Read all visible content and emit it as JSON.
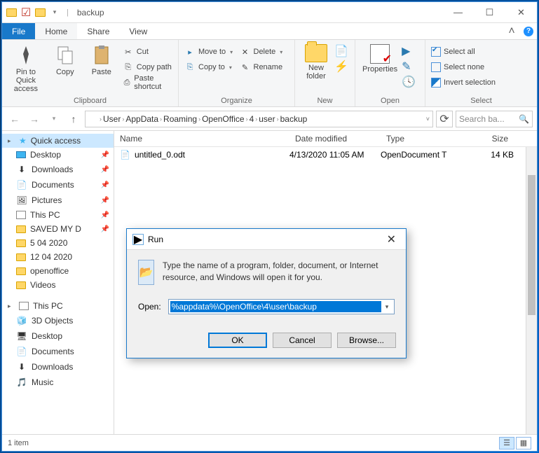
{
  "window_title": "backup",
  "menubar": {
    "file": "File",
    "tabs": [
      "Home",
      "Share",
      "View"
    ],
    "active": "Home"
  },
  "ribbon": {
    "clipboard": {
      "label": "Clipboard",
      "pin": "Pin to Quick\naccess",
      "copy": "Copy",
      "paste": "Paste",
      "cut": "Cut",
      "copy_path": "Copy path",
      "paste_shortcut": "Paste shortcut"
    },
    "organize": {
      "label": "Organize",
      "move": "Move to",
      "copy": "Copy to",
      "delete": "Delete",
      "rename": "Rename"
    },
    "new": {
      "label": "New",
      "folder": "New\nfolder"
    },
    "open": {
      "label": "Open",
      "properties": "Properties"
    },
    "select": {
      "label": "Select",
      "all": "Select all",
      "none": "Select none",
      "invert": "Invert selection"
    }
  },
  "breadcrumbs": [
    "User",
    "AppData",
    "Roaming",
    "OpenOffice",
    "4",
    "user",
    "backup"
  ],
  "search_placeholder": "Search ba...",
  "columns": {
    "name": "Name",
    "date": "Date modified",
    "type": "Type",
    "size": "Size"
  },
  "files": [
    {
      "name": "untitled_0.odt",
      "date": "4/13/2020 11:05 AM",
      "type": "OpenDocument T",
      "size": "14 KB"
    }
  ],
  "nav": {
    "quick_access": "Quick access",
    "quick_items": [
      {
        "label": "Desktop",
        "pinned": true,
        "icon": "monitor"
      },
      {
        "label": "Downloads",
        "pinned": true,
        "icon": "download"
      },
      {
        "label": "Documents",
        "pinned": true,
        "icon": "doc"
      },
      {
        "label": "Pictures",
        "pinned": true,
        "icon": "pic"
      },
      {
        "label": "This PC",
        "pinned": true,
        "icon": "pc"
      },
      {
        "label": "SAVED MY D",
        "pinned": true,
        "icon": "folder"
      },
      {
        "label": "5 04 2020",
        "pinned": false,
        "icon": "folder"
      },
      {
        "label": "12 04 2020",
        "pinned": false,
        "icon": "folder"
      },
      {
        "label": "openoffice",
        "pinned": false,
        "icon": "folder"
      },
      {
        "label": "Videos",
        "pinned": false,
        "icon": "folder"
      }
    ],
    "this_pc": "This PC",
    "pc_items": [
      "3D Objects",
      "Desktop",
      "Documents",
      "Downloads",
      "Music"
    ]
  },
  "status": "1 item",
  "run": {
    "title": "Run",
    "desc": "Type the name of a program, folder, document, or Internet resource, and Windows will open it for you.",
    "open_label": "Open:",
    "value": "%appdata%\\OpenOffice\\4\\user\\backup",
    "ok": "OK",
    "cancel": "Cancel",
    "browse": "Browse..."
  }
}
